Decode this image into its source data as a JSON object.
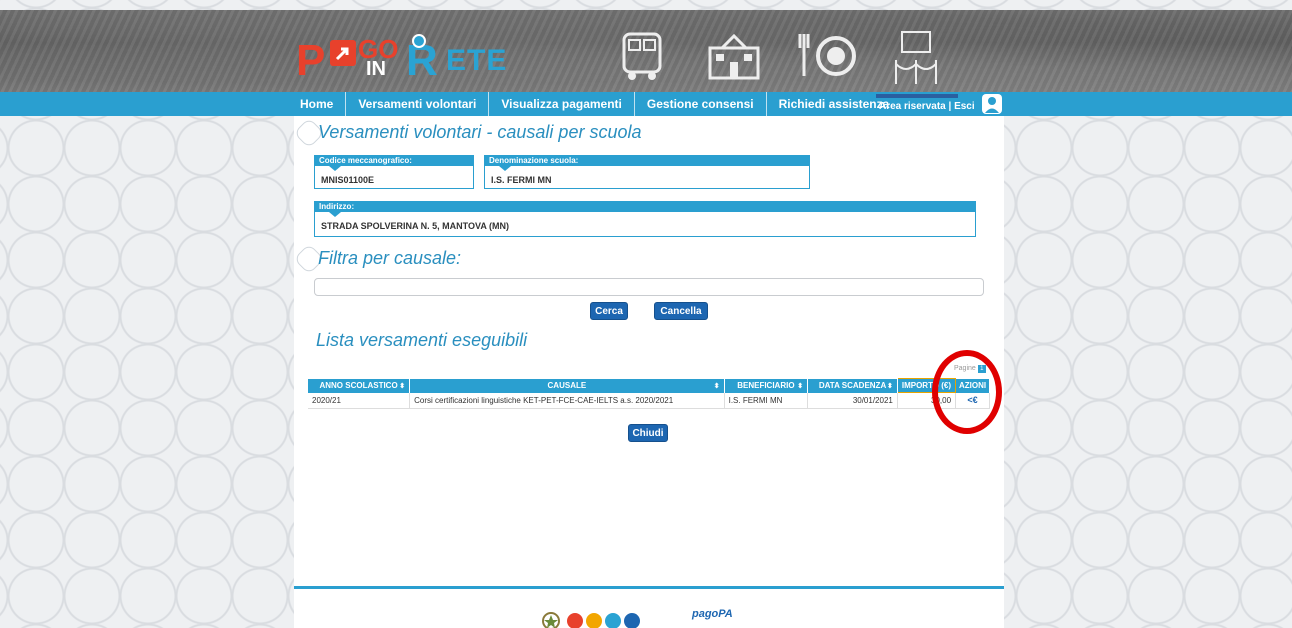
{
  "brand": {
    "logo_p": "P",
    "logo_go": "GO",
    "logo_in": "IN",
    "logo_r": "R",
    "logo_ete": "ETE"
  },
  "nav": {
    "items": [
      "Home",
      "Versamenti volontari",
      "Visualizza pagamenti",
      "Gestione consensi",
      "Richiedi assistenza"
    ],
    "right_links": "Area riservata | Esci"
  },
  "page": {
    "title": "Versamenti volontari - causali per scuola",
    "codice_label": "Codice meccanografico:",
    "codice_value": "MNIS01100E",
    "denominazione_label": "Denominazione scuola:",
    "denominazione_value": "I.S. FERMI MN",
    "indirizzo_label": "Indirizzo:",
    "indirizzo_value": "STRADA SPOLVERINA N. 5, MANTOVA (MN)",
    "filter_title": "Filtra per causale:",
    "filter_value": "",
    "search_button": "Cerca",
    "cancel_button": "Cancella",
    "list_title": "Lista versamenti eseguibili",
    "pager_label": "Pagine",
    "pager_page": "1",
    "close_button": "Chiudi"
  },
  "table": {
    "headers": [
      "ANNO SCOLASTICO",
      "CAUSALE",
      "BENEFICIARIO",
      "DATA SCADENZA",
      "IMPORTO (€)",
      "AZIONI"
    ],
    "rows": [
      {
        "anno": "2020/21",
        "causale": "Corsi certificazioni linguistiche KET-PET-FCE-CAE-IELTS a.s. 2020/2021",
        "beneficiario": "I.S. FERMI MN",
        "scadenza": "30/01/2021",
        "importo": "30,00",
        "azione": "<€"
      }
    ]
  },
  "footer": {
    "pagopa": "pagoPA"
  },
  "colors": {
    "accent": "#2a9fd0",
    "button": "#1d66b1",
    "brand_red": "#e8412c",
    "annotation": "#e00000"
  }
}
